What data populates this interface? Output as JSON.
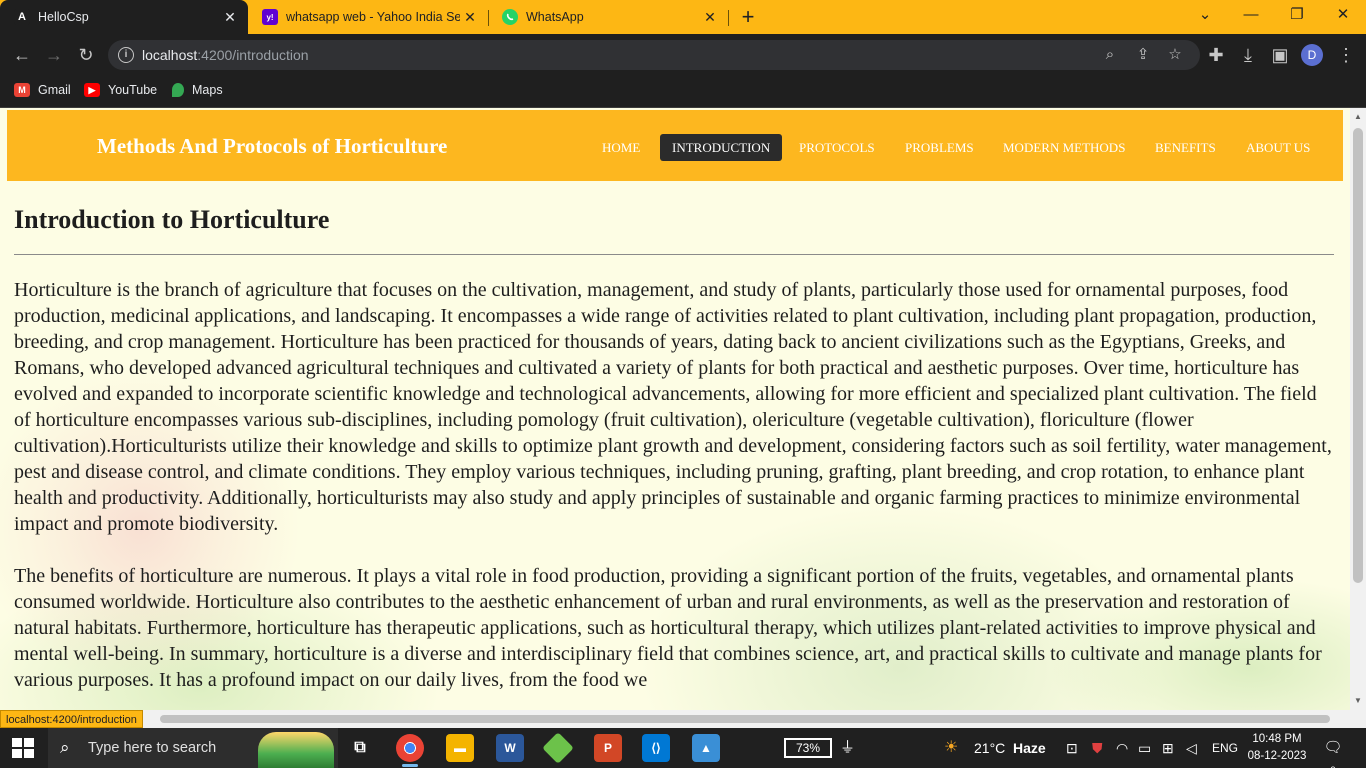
{
  "browser": {
    "tabs": [
      {
        "title": "HelloCsp",
        "favicon": "A",
        "active": true
      },
      {
        "title": "whatsapp web - Yahoo India Sear",
        "favicon": "y!",
        "active": false
      },
      {
        "title": "WhatsApp",
        "favicon": "whatsapp-icon",
        "active": false
      }
    ],
    "url_host": "localhost",
    "url_path": ":4200/introduction",
    "profile_initial": "D",
    "bookmarks": [
      {
        "label": "Gmail",
        "icon": "gmail-icon"
      },
      {
        "label": "YouTube",
        "icon": "youtube-icon"
      },
      {
        "label": "Maps",
        "icon": "maps-icon"
      }
    ],
    "status_url": "localhost:4200/introduction"
  },
  "site": {
    "title": "Methods And Protocols of Horticulture",
    "nav": [
      {
        "label": "HOME"
      },
      {
        "label": "INTRODUCTION"
      },
      {
        "label": "PROTOCOLS"
      },
      {
        "label": "PROBLEMS"
      },
      {
        "label": "MODERN METHODS"
      },
      {
        "label": "BENEFITS"
      },
      {
        "label": "ABOUT US"
      }
    ],
    "active_nav": "INTRODUCTION",
    "colors": {
      "header": "#fdb71f",
      "active_nav": "#2b2b2b",
      "background": "#fdfde4"
    }
  },
  "content": {
    "heading": "Introduction to Horticulture",
    "paragraphs": [
      "Horticulture is the branch of agriculture that focuses on the cultivation, management, and study of plants, particularly those used for ornamental purposes, food production, medicinal applications, and landscaping. It encompasses a wide range of activities related to plant cultivation, including plant propagation, production, breeding, and crop management. Horticulture has been practiced for thousands of years, dating back to ancient civilizations such as the Egyptians, Greeks, and Romans, who developed advanced agricultural techniques and cultivated a variety of plants for both practical and aesthetic purposes. Over time, horticulture has evolved and expanded to incorporate scientific knowledge and technological advancements, allowing for more efficient and specialized plant cultivation. The field of horticulture encompasses various sub-disciplines, including pomology (fruit cultivation), olericulture (vegetable cultivation), floriculture (flower cultivation).Horticulturists utilize their knowledge and skills to optimize plant growth and development, considering factors such as soil fertility, water management, pest and disease control, and climate conditions. They employ various techniques, including pruning, grafting, plant breeding, and crop rotation, to enhance plant health and productivity. Additionally, horticulturists may also study and apply principles of sustainable and organic farming practices to minimize environmental impact and promote biodiversity.",
      "The benefits of horticulture are numerous. It plays a vital role in food production, providing a significant portion of the fruits, vegetables, and ornamental plants consumed worldwide. Horticulture also contributes to the aesthetic enhancement of urban and rural environments, as well as the preservation and restoration of natural habitats. Furthermore, horticulture has therapeutic applications, such as horticultural therapy, which utilizes plant-related activities to improve physical and mental well-being. In summary, horticulture is a diverse and interdisciplinary field that combines science, art, and practical skills to cultivate and manage plants for various purposes. It has a profound impact on our daily lives, from the food we"
    ]
  },
  "taskbar": {
    "search_placeholder": "Type here to search",
    "battery": "73%",
    "weather_temp": "21°C",
    "weather_desc": "Haze",
    "language": "ENG",
    "time": "10:48 PM",
    "date": "08-12-2023",
    "notifications": "3"
  }
}
